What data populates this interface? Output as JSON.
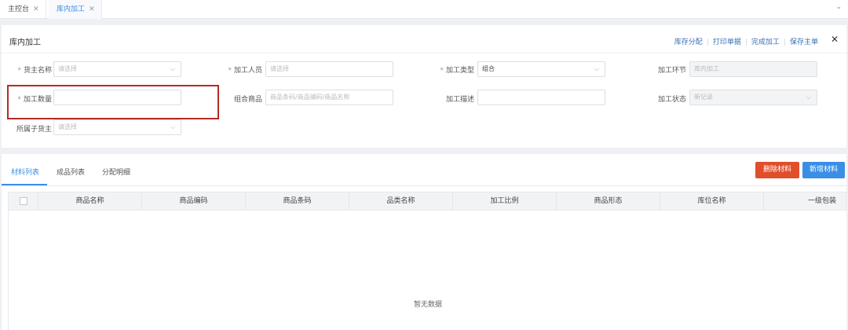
{
  "tabs": [
    {
      "label": "主控台",
      "close": "✕",
      "active": false
    },
    {
      "label": "库内加工",
      "close": "✕",
      "active": true
    }
  ],
  "tab_dropdown": "⌄",
  "form_panel": {
    "title": "库内加工",
    "actions": [
      "库存分配",
      "打印单据",
      "完成加工",
      "保存主单"
    ],
    "close": "✕",
    "fields": {
      "owner_name": {
        "label": "货主名称",
        "required": true,
        "placeholder": "请选择"
      },
      "worker": {
        "label": "加工人员",
        "required": true,
        "placeholder": "请选择"
      },
      "proc_type": {
        "label": "加工类型",
        "required": true,
        "value": "组合"
      },
      "proc_stage": {
        "label": "加工环节",
        "value": "库内加工"
      },
      "proc_qty": {
        "label": "加工数量",
        "required": true,
        "value": ""
      },
      "combo_goods": {
        "label": "组合商品",
        "placeholder": "商品条码/商品编码/商品名称"
      },
      "proc_desc": {
        "label": "加工描述",
        "value": ""
      },
      "proc_status": {
        "label": "加工状态",
        "value": "新记录"
      },
      "sub_owner": {
        "label": "所属子货主",
        "placeholder": "请选择"
      }
    }
  },
  "list_panel": {
    "tabs": [
      "材料列表",
      "成品列表",
      "分配明细"
    ],
    "active_tab": "材料列表",
    "delete_button": "删除材料",
    "add_button": "新增材料",
    "columns": [
      "商品名称",
      "商品编码",
      "商品条码",
      "品类名称",
      "加工比例",
      "商品形态",
      "库位名称",
      "一级包装"
    ],
    "rows": [],
    "empty_text": "暂无数据"
  },
  "colors": {
    "accent": "#3a8ee6",
    "danger": "#e04e2a",
    "highlight": "#b42a28"
  }
}
